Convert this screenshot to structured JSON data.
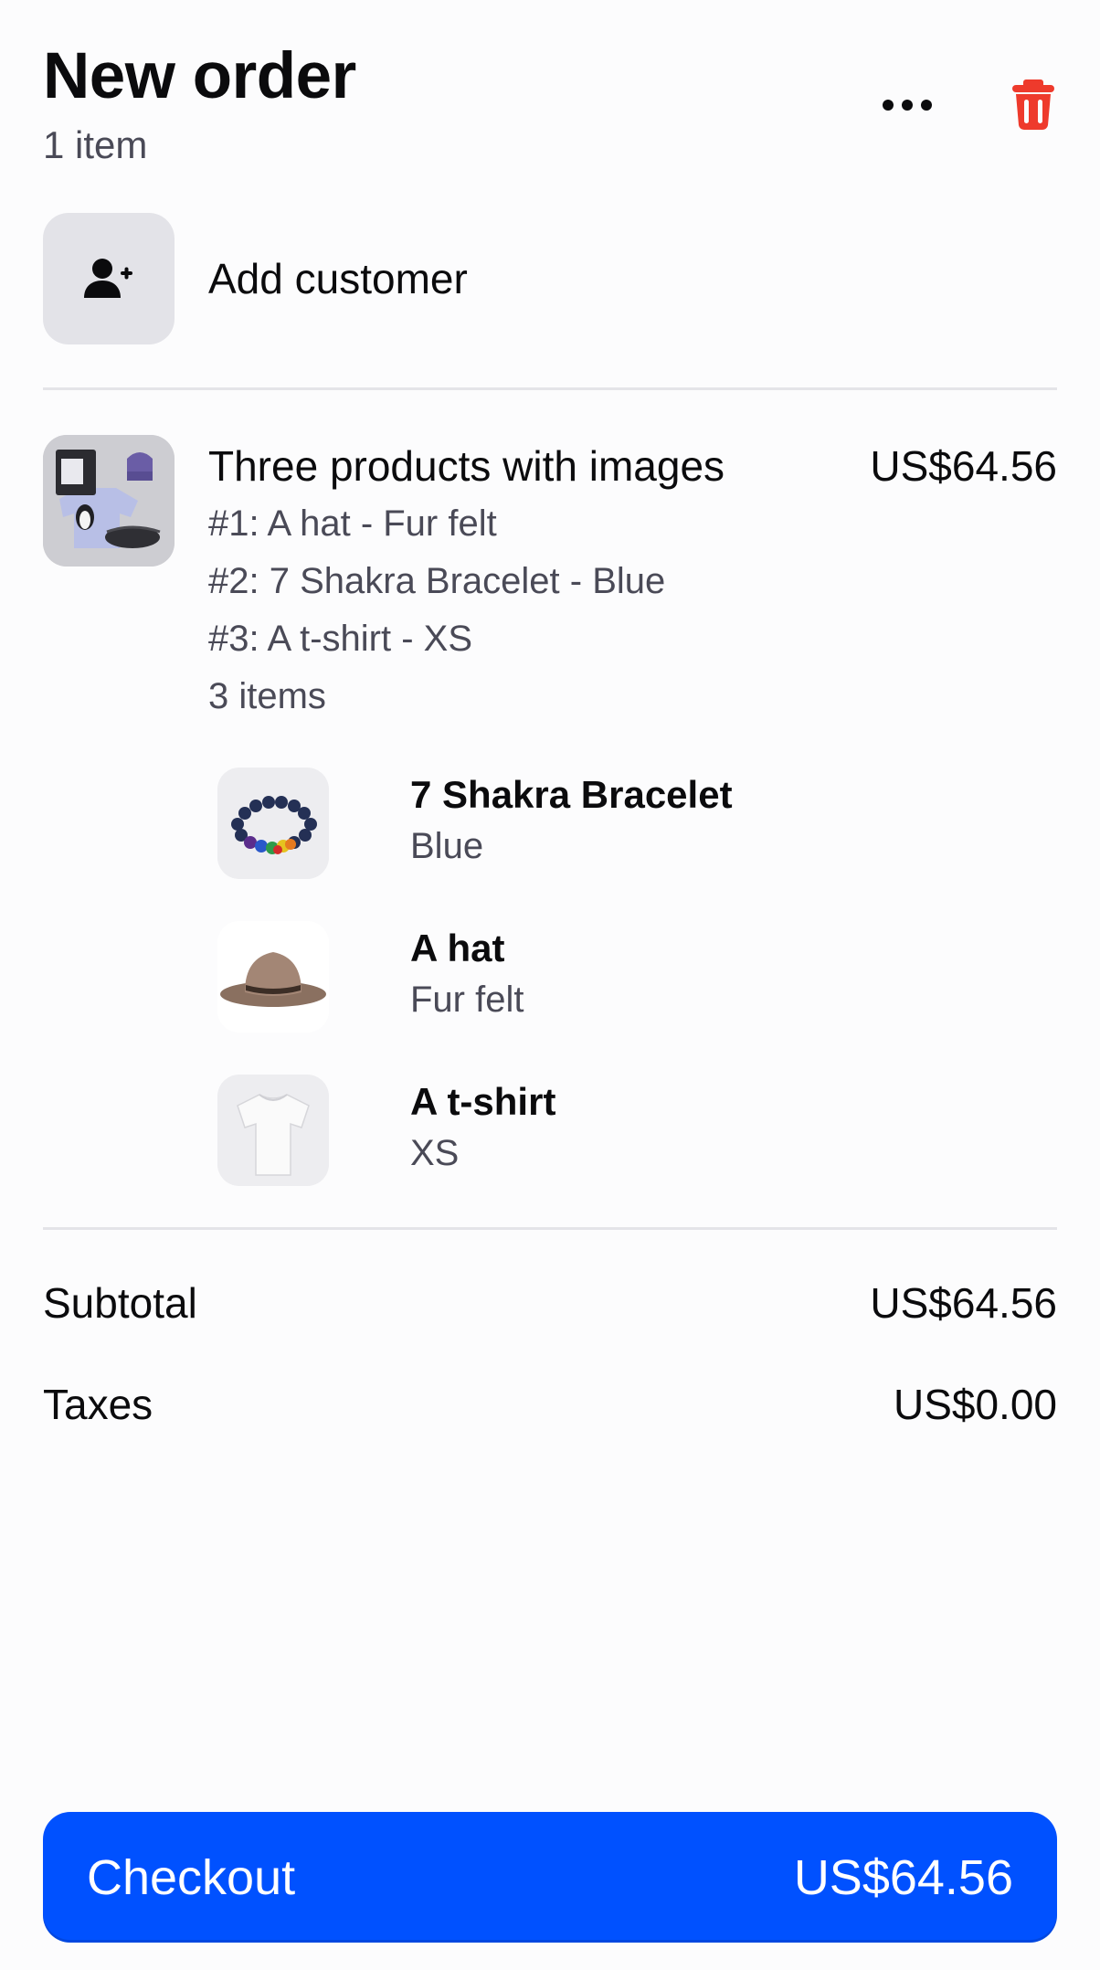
{
  "header": {
    "title": "New order",
    "subtitle": "1 item",
    "more_icon": "more-horizontal-icon",
    "trash_icon": "trash-icon",
    "trash_color": "#ee3a2c"
  },
  "customer": {
    "label": "Add customer",
    "icon": "add-person-icon"
  },
  "line_item": {
    "title": "Three products with images",
    "price": "US$64.56",
    "details": [
      "#1: A hat - Fur felt",
      "#2: 7 Shakra Bracelet - Blue",
      "#3: A t-shirt - XS"
    ],
    "count": "3 items",
    "components": [
      {
        "name": "7 Shakra Bracelet",
        "variant": "Blue",
        "image": "bracelet"
      },
      {
        "name": "A hat",
        "variant": "Fur felt",
        "image": "hat"
      },
      {
        "name": "A t-shirt",
        "variant": "XS",
        "image": "t-shirt"
      }
    ]
  },
  "summary": {
    "subtotal_label": "Subtotal",
    "subtotal_value": "US$64.56",
    "taxes_label": "Taxes",
    "taxes_value": "US$0.00"
  },
  "checkout": {
    "label": "Checkout",
    "total": "US$64.56",
    "color": "#0051ff"
  }
}
